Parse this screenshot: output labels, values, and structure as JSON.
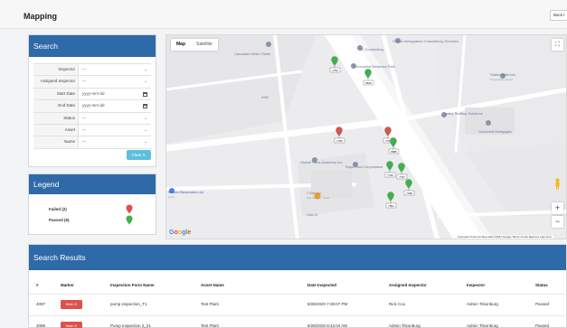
{
  "header": {
    "title": "Mapping",
    "back_label": "Back t"
  },
  "search": {
    "title": "Search",
    "fields": [
      {
        "label": "Inspector",
        "value": "---",
        "kind": "select"
      },
      {
        "label": "Assigned Inspector",
        "value": "---",
        "kind": "select"
      },
      {
        "label": "Start Date",
        "value": "yyyy-mm-dd",
        "kind": "date"
      },
      {
        "label": "End Date",
        "value": "yyyy-mm-dd",
        "kind": "date"
      },
      {
        "label": "Status",
        "value": "---",
        "kind": "select"
      },
      {
        "label": "Asset",
        "value": "---",
        "kind": "select"
      },
      {
        "label": "Name",
        "value": "---",
        "kind": "select"
      }
    ],
    "clear_label": "Clear ↻"
  },
  "legend": {
    "title": "Legend",
    "failed_label": "Failed (2)",
    "passed_label": "Passed (6)",
    "failed_color": "#d9534f",
    "passed_color": "#3cb44b"
  },
  "map": {
    "tabs": [
      "Map",
      "Satellite"
    ],
    "places": {
      "canadian_metro": "Canadian Metro Finish",
      "tc_contracting": "TC Contracting",
      "global_immigration": "Global Immigration Consultancy Services",
      "industrial_park": "Industrial Business Park",
      "station_interiors": "Station Interiors",
      "station_interiors_sub": "Temporarily closed",
      "valley_staffing": "Valley Staffing Solutions",
      "goldcrest": "Goldcrest Mortgages",
      "global_truck": "Global Truck Academy Inc",
      "rupa_tech": "Rupa Tech Corporation",
      "seven_eleven": "7-Eleven",
      "seven_eleven_sub": "Gas Station · Shop",
      "nexus": "Nexus Electronics Ltd",
      "nexus_sub": "Store",
      "road_label": "Gate 20",
      "block_label": "9400"
    },
    "markers": [
      {
        "label": "7752",
        "status": "passed"
      },
      {
        "label": "8816",
        "status": "passed"
      },
      {
        "label": "7780",
        "status": "failed"
      },
      {
        "label": "7752",
        "status": "failed"
      },
      {
        "label": "8885",
        "status": "passed"
      },
      {
        "label": "7796",
        "status": "passed"
      },
      {
        "label": "7797",
        "status": "passed"
      },
      {
        "label": "7788",
        "status": "passed"
      },
      {
        "label": "7821",
        "status": "passed"
      }
    ],
    "attribution": "Keyboard shortcuts   Map data ©2021 Google   Terms of Use   Report a map error"
  },
  "results": {
    "title": "Search Results",
    "columns": [
      "#",
      "Marker",
      "Inspection Form Name",
      "Asset Name",
      "Date Inspected",
      "Assigned Inspector",
      "Inspector",
      "Status"
    ],
    "rows": [
      {
        "id": "4087",
        "marker": "Hide ⊙",
        "form": "pump inspection_T1",
        "asset": "Test Plant",
        "date": "8/28/2020 7:39:07 PM",
        "assigned": "Rick Cox",
        "inspector": "Admin Tilsonburg",
        "status": "Passed"
      },
      {
        "id": "3089",
        "marker": "Hide ⊙",
        "form": "Pump Inspection 2_21",
        "asset": "Test Plant",
        "date": "8/28/2020 8:42:04 AM",
        "assigned": "Admin Tilsonburg",
        "inspector": "Admin Tilsonburg",
        "status": "Passed"
      }
    ]
  }
}
